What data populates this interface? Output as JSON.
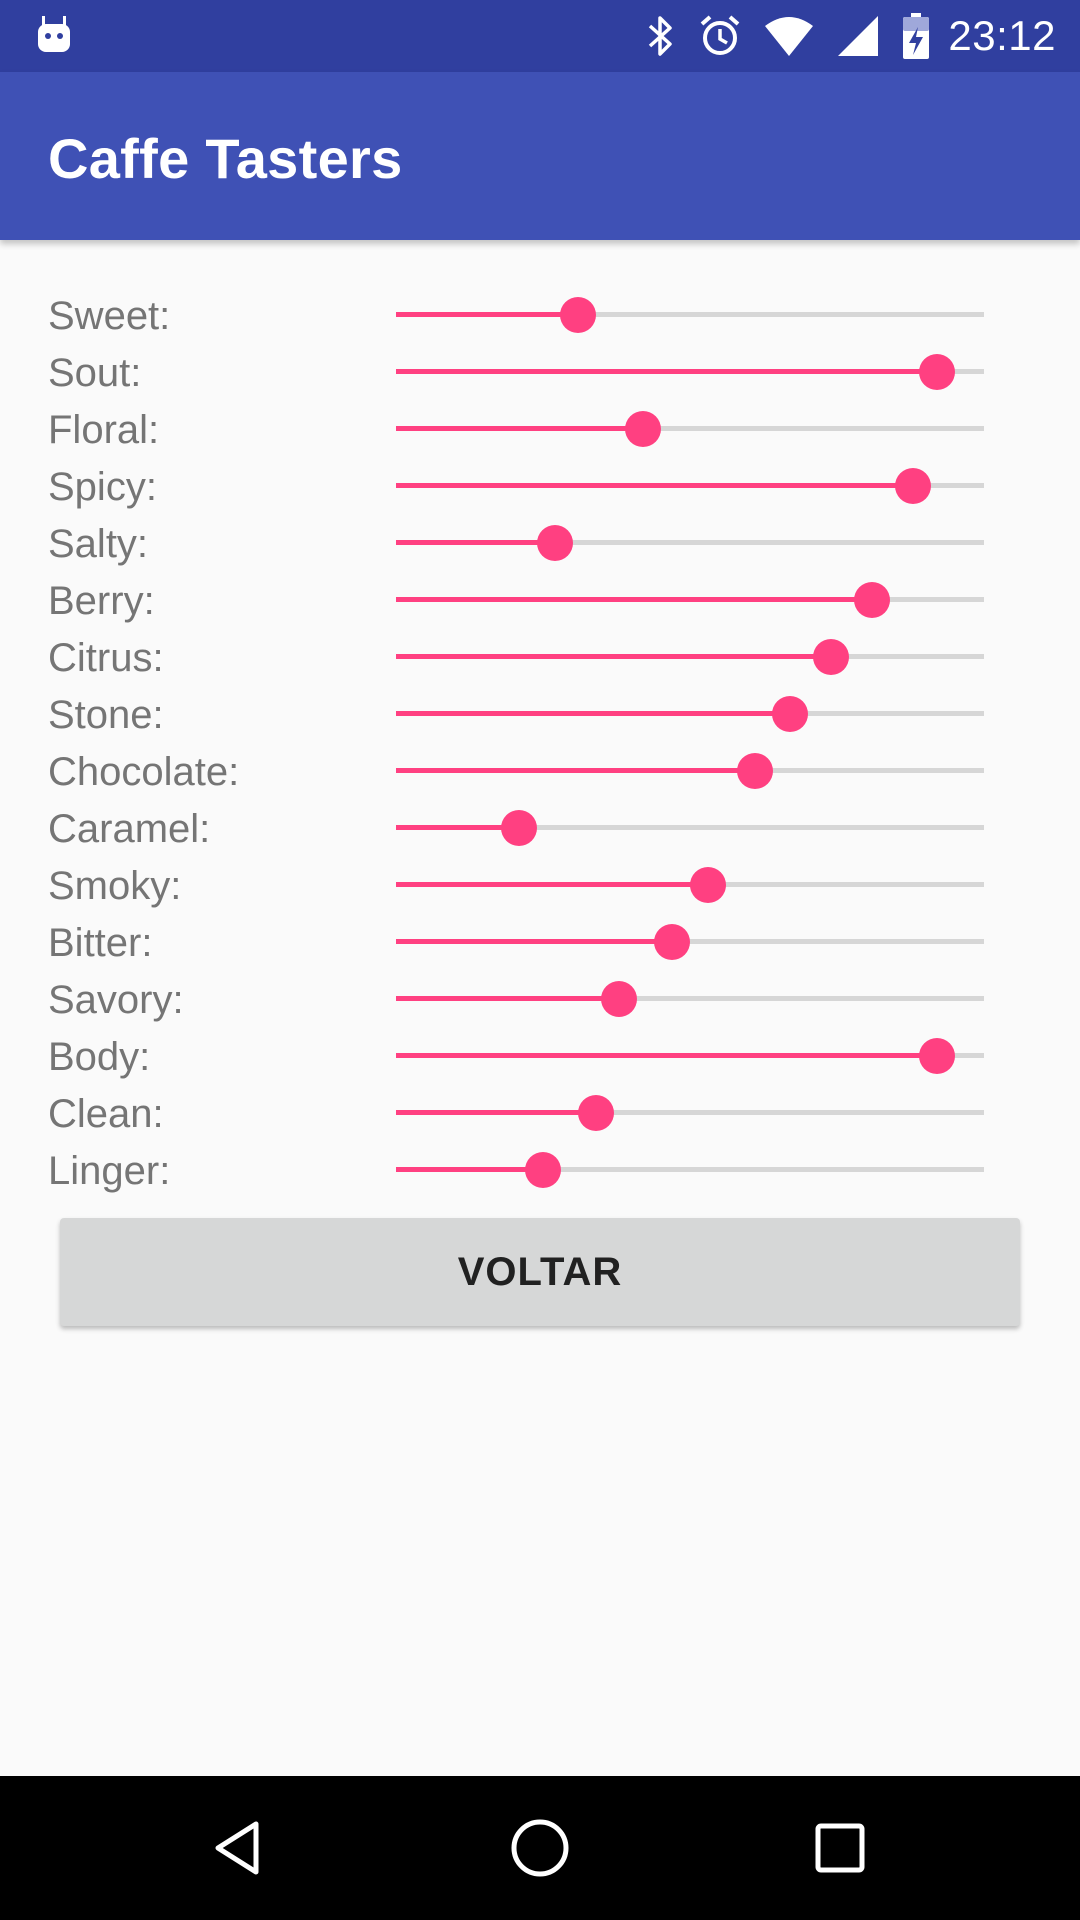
{
  "status_bar": {
    "time": "23:12",
    "icons": [
      "android-notification-icon",
      "bluetooth-icon",
      "alarm-icon",
      "wifi-icon",
      "cell-signal-icon",
      "battery-charging-icon"
    ]
  },
  "app_bar": {
    "title": "Caffe Tasters"
  },
  "accent_color": "#ff4081",
  "primary_color": "#3f51b5",
  "primary_dark_color": "#303f9f",
  "sliders": [
    {
      "label": "Sweet:",
      "value": 0.31
    },
    {
      "label": "Sout:",
      "value": 0.92
    },
    {
      "label": "Floral:",
      "value": 0.42
    },
    {
      "label": "Spicy:",
      "value": 0.88
    },
    {
      "label": "Salty:",
      "value": 0.27
    },
    {
      "label": "Berry:",
      "value": 0.81
    },
    {
      "label": "Citrus:",
      "value": 0.74
    },
    {
      "label": "Stone:",
      "value": 0.67
    },
    {
      "label": "Chocolate:",
      "value": 0.61
    },
    {
      "label": "Caramel:",
      "value": 0.21
    },
    {
      "label": "Smoky:",
      "value": 0.53
    },
    {
      "label": "Bitter:",
      "value": 0.47
    },
    {
      "label": "Savory:",
      "value": 0.38
    },
    {
      "label": "Body:",
      "value": 0.92
    },
    {
      "label": "Clean:",
      "value": 0.34
    },
    {
      "label": "Linger:",
      "value": 0.25
    }
  ],
  "button": {
    "label": "VOLTAR"
  },
  "nav_bar": {
    "icons": [
      "back-icon",
      "home-icon",
      "recents-icon"
    ]
  }
}
